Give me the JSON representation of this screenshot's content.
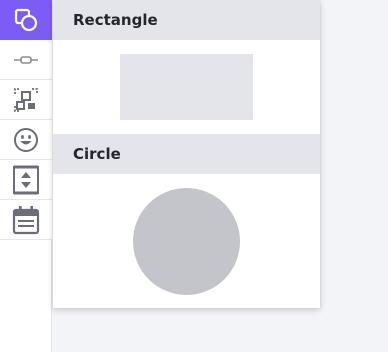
{
  "toolbar": {
    "items": [
      {
        "icon": "shapes-icon",
        "active": true
      },
      {
        "icon": "line-icon"
      },
      {
        "icon": "qr-code-icon"
      },
      {
        "icon": "emoji-icon"
      },
      {
        "icon": "stepper-icon"
      },
      {
        "icon": "calendar-icon"
      }
    ],
    "active_color": "#7c5cf6"
  },
  "panel": {
    "sections": [
      {
        "title": "Rectangle",
        "shape": "rectangle"
      },
      {
        "title": "Circle",
        "shape": "circle"
      }
    ]
  }
}
